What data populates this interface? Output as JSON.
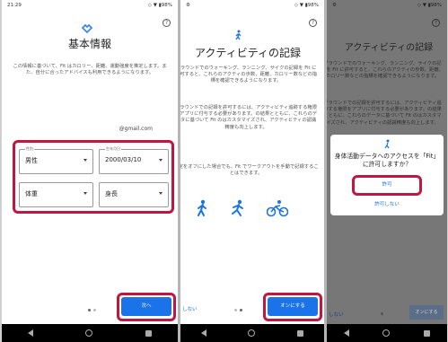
{
  "screen1": {
    "status": {
      "time": "21:29",
      "right": "◇ ▼ ▮98%"
    },
    "title": "基本情報",
    "description": "この情報に基づいて、Fit はカロリー、距離、運動強度を推定します。また、自分に合ったアドバイスも利用できるようになります。",
    "email": "@gmail.com",
    "fields": {
      "sex_label": "性別",
      "sex_value": "男性",
      "dob_label": "生年月日",
      "dob_value": "2000/03/10",
      "weight_value": "体重",
      "height_value": "身長"
    },
    "next_button": "次へ"
  },
  "screen2": {
    "status": {
      "right": "◇ ▼ ▮98%"
    },
    "title": "アクティビティの記録",
    "description1": "グラウンドでのウォーキング、ランニング、サイクの記録を Fit に許可すると、これらのアクティの歩数、距離、カロリー数などの指標を確認できるようになります。",
    "description2": "グラウンドでの記録を許可するには、アクティビティ追跡する権限をアプリに付与する必要があります。の結果とともに、これらのデータに基づいて Fit のはカスタマイズされ、アクティビティの認識精度も向上します。",
    "description3": "設定をオフにした場合でも、Fit でワークアウトを手動で記録することはできます。",
    "skip_button": "しない",
    "enable_button": "オンにする",
    "activity_icons": [
      "walking-icon",
      "running-icon",
      "cycling-icon"
    ]
  },
  "screen3": {
    "status": {
      "right": "◇ ▼ ▮98%"
    },
    "title": "アクティビティの記録",
    "dialog_title": "身体活動データへのアクセスを「Fit」に許可しますか？",
    "allow_button": "許可",
    "deny_button": "許可しない",
    "skip_button": "しない",
    "enable_button": "オンにする"
  },
  "colors": {
    "accent": "#1a73e8",
    "highlight": "#c0163f"
  }
}
